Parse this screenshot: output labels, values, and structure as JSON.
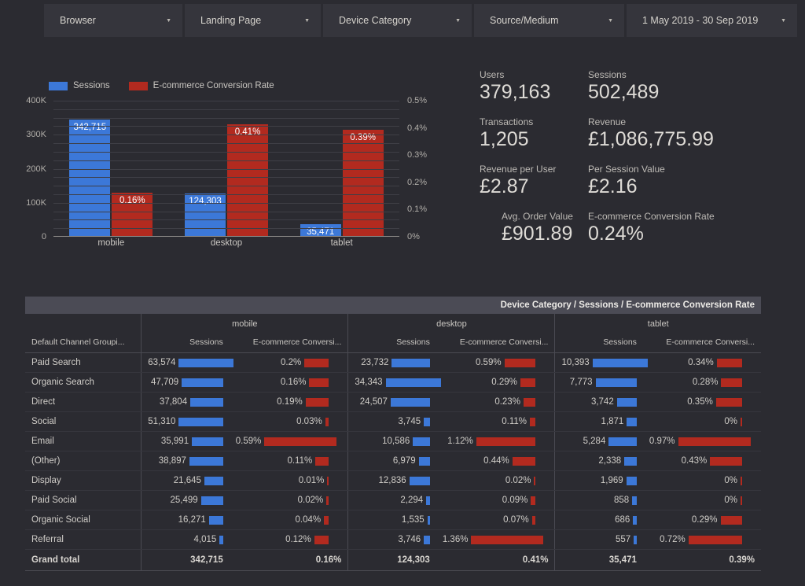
{
  "filters": [
    {
      "label": "Browser",
      "caret": "chevron-down-icon"
    },
    {
      "label": "Landing Page",
      "caret": "chevron-down-icon"
    },
    {
      "label": "Device Category",
      "caret": "chevron-down-icon"
    },
    {
      "label": "Source/Medium",
      "caret": "chevron-down-icon"
    },
    {
      "label": "1 May 2019 - 30 Sep 2019",
      "caret": "chevron-down-icon"
    }
  ],
  "colors": {
    "background": "#2b2b31",
    "panel": "#35353c",
    "blue": "#3c78d8",
    "red": "#b22a1f",
    "banner": "#4b4b55",
    "text": "#cfccc7"
  },
  "chart_data": {
    "type": "bar",
    "title": "",
    "categories": [
      "mobile",
      "desktop",
      "tablet"
    ],
    "series": [
      {
        "name": "Sessions",
        "color": "#3c78d8",
        "axis": "left",
        "values": [
          342715,
          124303,
          35471
        ],
        "labels": [
          "342,715",
          "124,303",
          "35,471"
        ]
      },
      {
        "name": "E-commerce Conversion Rate",
        "color": "#b22a1f",
        "axis": "right",
        "values": [
          0.16,
          0.41,
          0.39
        ],
        "labels": [
          "0.16%",
          "0.41%",
          "0.39%"
        ]
      }
    ],
    "legend": [
      "Sessions",
      "E-commerce Conversion Rate"
    ],
    "legend_position": "top-left",
    "left_axis": {
      "label": "",
      "ticks": [
        "0",
        "100K",
        "200K",
        "300K",
        "400K"
      ],
      "tick_values": [
        0,
        100000,
        200000,
        300000,
        400000
      ],
      "min": 0,
      "max": 400000
    },
    "right_axis": {
      "label": "",
      "ticks": [
        "0%",
        "0.1%",
        "0.2%",
        "0.3%",
        "0.4%",
        "0.5%"
      ],
      "tick_values": [
        0,
        0.1,
        0.2,
        0.3,
        0.4,
        0.5
      ],
      "min": 0,
      "max": 0.5
    },
    "grid": true,
    "grid_interval": 25000
  },
  "scorecards": [
    {
      "title": "Users",
      "value": "379,163"
    },
    {
      "title": "Sessions",
      "value": "502,489"
    },
    {
      "title": "Transactions",
      "value": "1,205"
    },
    {
      "title": "Revenue",
      "value": "£1,086,775.99"
    },
    {
      "title": "Revenue per User",
      "value": "£2.87"
    },
    {
      "title": "Per Session Value",
      "value": "£2.16"
    },
    {
      "title": "Avg. Order Value",
      "value": "£901.89"
    },
    {
      "title": "E-commerce Conversion Rate",
      "value": "0.24%"
    }
  ],
  "table": {
    "banner": "Device Category / Sessions / E-commerce Conversion Rate",
    "groups": [
      "",
      "mobile",
      "desktop",
      "tablet"
    ],
    "dimension_header": "Default Channel Groupi...",
    "metric_headers": [
      "Sessions",
      "E-commerce Conversi..."
    ],
    "rows": [
      {
        "dim": "Paid Search",
        "mobile": {
          "sessions": "63,574",
          "sessions_v": 63574,
          "rate": "0.2%",
          "rate_v": 0.2
        },
        "desktop": {
          "sessions": "23,732",
          "sessions_v": 23732,
          "rate": "0.59%",
          "rate_v": 0.59
        },
        "tablet": {
          "sessions": "10,393",
          "sessions_v": 10393,
          "rate": "0.34%",
          "rate_v": 0.34
        }
      },
      {
        "dim": "Organic Search",
        "mobile": {
          "sessions": "47,709",
          "sessions_v": 47709,
          "rate": "0.16%",
          "rate_v": 0.16
        },
        "desktop": {
          "sessions": "34,343",
          "sessions_v": 34343,
          "rate": "0.29%",
          "rate_v": 0.29
        },
        "tablet": {
          "sessions": "7,773",
          "sessions_v": 7773,
          "rate": "0.28%",
          "rate_v": 0.28
        }
      },
      {
        "dim": "Direct",
        "mobile": {
          "sessions": "37,804",
          "sessions_v": 37804,
          "rate": "0.19%",
          "rate_v": 0.19
        },
        "desktop": {
          "sessions": "24,507",
          "sessions_v": 24507,
          "rate": "0.23%",
          "rate_v": 0.23
        },
        "tablet": {
          "sessions": "3,742",
          "sessions_v": 3742,
          "rate": "0.35%",
          "rate_v": 0.35
        }
      },
      {
        "dim": "Social",
        "mobile": {
          "sessions": "51,310",
          "sessions_v": 51310,
          "rate": "0.03%",
          "rate_v": 0.03
        },
        "desktop": {
          "sessions": "3,745",
          "sessions_v": 3745,
          "rate": "0.11%",
          "rate_v": 0.11
        },
        "tablet": {
          "sessions": "1,871",
          "sessions_v": 1871,
          "rate": "0%",
          "rate_v": 0.0
        }
      },
      {
        "dim": "Email",
        "mobile": {
          "sessions": "35,991",
          "sessions_v": 35991,
          "rate": "0.59%",
          "rate_v": 0.59
        },
        "desktop": {
          "sessions": "10,586",
          "sessions_v": 10586,
          "rate": "1.12%",
          "rate_v": 1.12
        },
        "tablet": {
          "sessions": "5,284",
          "sessions_v": 5284,
          "rate": "0.97%",
          "rate_v": 0.97
        }
      },
      {
        "dim": "(Other)",
        "mobile": {
          "sessions": "38,897",
          "sessions_v": 38897,
          "rate": "0.11%",
          "rate_v": 0.11
        },
        "desktop": {
          "sessions": "6,979",
          "sessions_v": 6979,
          "rate": "0.44%",
          "rate_v": 0.44
        },
        "tablet": {
          "sessions": "2,338",
          "sessions_v": 2338,
          "rate": "0.43%",
          "rate_v": 0.43
        }
      },
      {
        "dim": "Display",
        "mobile": {
          "sessions": "21,645",
          "sessions_v": 21645,
          "rate": "0.01%",
          "rate_v": 0.01
        },
        "desktop": {
          "sessions": "12,836",
          "sessions_v": 12836,
          "rate": "0.02%",
          "rate_v": 0.02
        },
        "tablet": {
          "sessions": "1,969",
          "sessions_v": 1969,
          "rate": "0%",
          "rate_v": 0.0
        }
      },
      {
        "dim": "Paid Social",
        "mobile": {
          "sessions": "25,499",
          "sessions_v": 25499,
          "rate": "0.02%",
          "rate_v": 0.02
        },
        "desktop": {
          "sessions": "2,294",
          "sessions_v": 2294,
          "rate": "0.09%",
          "rate_v": 0.09
        },
        "tablet": {
          "sessions": "858",
          "sessions_v": 858,
          "rate": "0%",
          "rate_v": 0.0
        }
      },
      {
        "dim": "Organic Social",
        "mobile": {
          "sessions": "16,271",
          "sessions_v": 16271,
          "rate": "0.04%",
          "rate_v": 0.04
        },
        "desktop": {
          "sessions": "1,535",
          "sessions_v": 1535,
          "rate": "0.07%",
          "rate_v": 0.07
        },
        "tablet": {
          "sessions": "686",
          "sessions_v": 686,
          "rate": "0.29%",
          "rate_v": 0.29
        }
      },
      {
        "dim": "Referral",
        "mobile": {
          "sessions": "4,015",
          "sessions_v": 4015,
          "rate": "0.12%",
          "rate_v": 0.12
        },
        "desktop": {
          "sessions": "3,746",
          "sessions_v": 3746,
          "rate": "1.36%",
          "rate_v": 1.36
        },
        "tablet": {
          "sessions": "557",
          "sessions_v": 557,
          "rate": "0.72%",
          "rate_v": 0.72
        }
      }
    ],
    "total": {
      "label": "Grand total",
      "mobile": {
        "sessions": "342,715",
        "rate": "0.16%"
      },
      "desktop": {
        "sessions": "124,303",
        "rate": "0.41%"
      },
      "tablet": {
        "sessions": "35,471",
        "rate": "0.39%"
      }
    }
  }
}
